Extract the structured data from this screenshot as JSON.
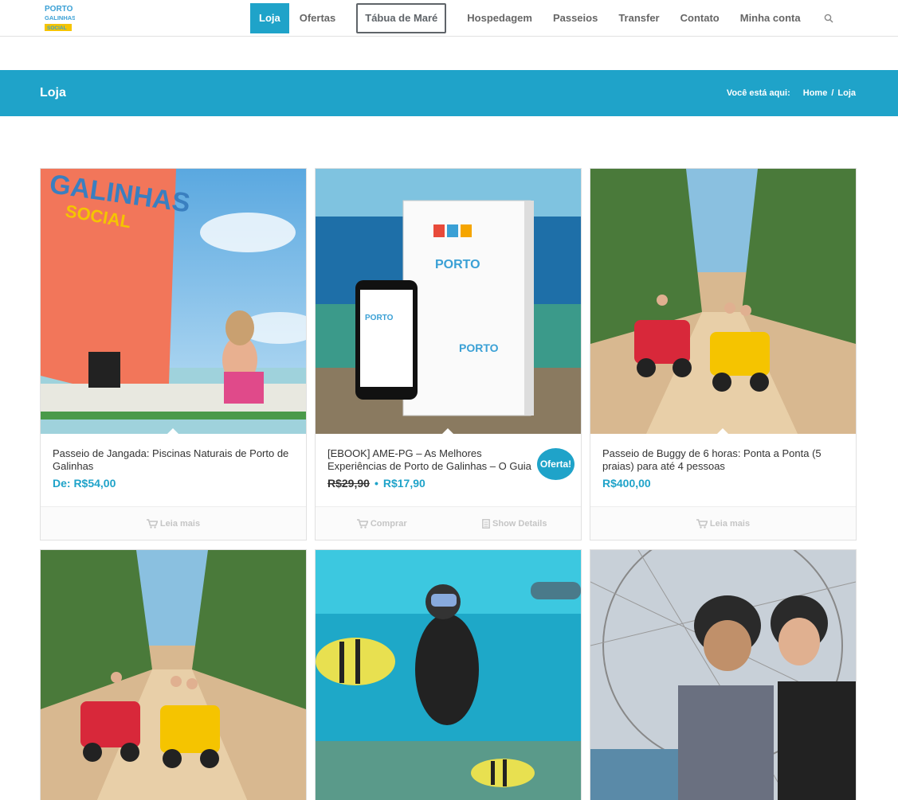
{
  "header": {
    "logo_text_line1": "PORTO",
    "logo_text_line2": "GALINHAS",
    "logo_text_line3": "SOCIAL",
    "nav": [
      {
        "label": "Loja"
      },
      {
        "label": "Ofertas"
      },
      {
        "label": "Tábua de Maré"
      },
      {
        "label": "Hospedagem"
      },
      {
        "label": "Passeios"
      },
      {
        "label": "Transfer"
      },
      {
        "label": "Contato"
      },
      {
        "label": "Minha conta"
      }
    ],
    "search_icon": "search-icon"
  },
  "titlebar": {
    "title": "Loja",
    "breadcrumb_prefix": "Você está aqui:",
    "breadcrumb_home": "Home",
    "breadcrumb_sep": "/",
    "breadcrumb_current": "Loja"
  },
  "products": [
    {
      "name": "Passeio de Jangada: Piscinas Naturais de Porto de Galinhas",
      "price": "De: R$54,00",
      "action": "Leia mais"
    },
    {
      "name": "[EBOOK] AME-PG – As Melhores Experiências de Porto de Galinhas – O Guia",
      "old_price": "R$29,90",
      "price_sep": "•",
      "price": "R$17,90",
      "badge": "Oferta!",
      "action": "Comprar",
      "action2": "Show Details"
    },
    {
      "name": "Passeio de Buggy de 6 horas: Ponta a Ponta (5 praias) para até 4 pessoas",
      "price": "R$400,00",
      "action": "Leia mais"
    }
  ],
  "colors": {
    "accent": "#1fa3c9",
    "nav_text": "#666666",
    "muted": "#c5c5c5"
  }
}
